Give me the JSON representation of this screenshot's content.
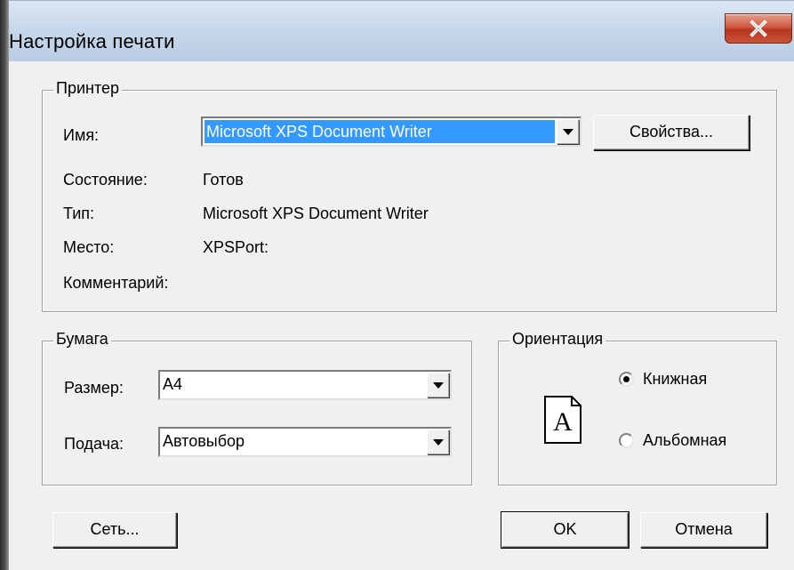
{
  "window": {
    "title": "Настройка печати",
    "close_icon": "close-x-icon",
    "close_color": "#c9533a"
  },
  "printer": {
    "legend": "Принтер",
    "name_label": "Имя:",
    "name_value": "Microsoft XPS Document Writer",
    "properties_button": "Свойства...",
    "status_label": "Состояние:",
    "status_value": "Готов",
    "type_label": "Тип:",
    "type_value": "Microsoft XPS Document Writer",
    "location_label": "Место:",
    "location_value": "XPSPort:",
    "comment_label": "Комментарий:"
  },
  "paper": {
    "legend": "Бумага",
    "size_label": "Размер:",
    "size_value": "A4",
    "source_label": "Подача:",
    "source_value": "Автовыбор"
  },
  "orientation": {
    "legend": "Ориентация",
    "icon": "page-portrait-icon",
    "icon_letter": "A",
    "portrait_label": "Книжная",
    "landscape_label": "Альбомная",
    "selected": "portrait"
  },
  "buttons": {
    "network": "Сеть...",
    "ok": "OK",
    "cancel": "Отмена"
  },
  "colors": {
    "selection": "#3399ff",
    "face": "#f0f0f0"
  }
}
